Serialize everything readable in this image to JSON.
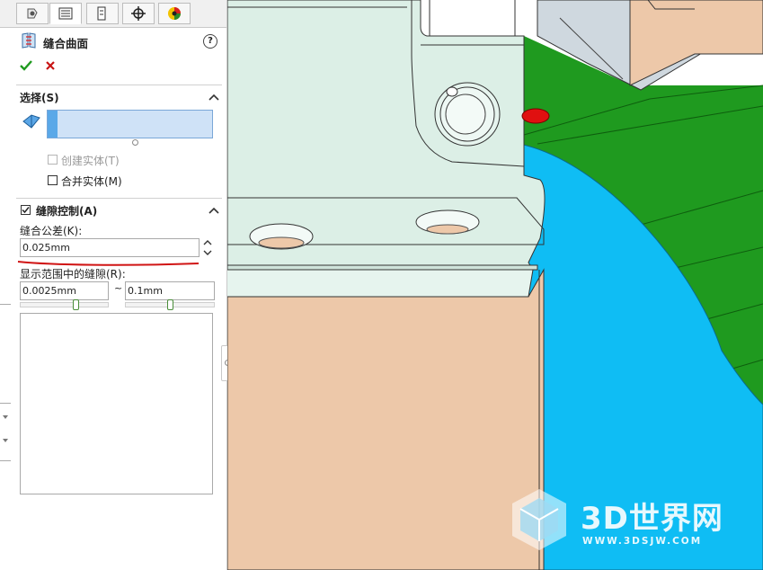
{
  "panel": {
    "title": "缝合曲面",
    "help_label": "?",
    "tabs": [
      "feature-manager",
      "property-manager",
      "configuration-manager",
      "dimxpert-manager",
      "display-manager"
    ]
  },
  "selection": {
    "header": "选择(S)",
    "create_solid": "创建实体(T)",
    "merge_entities": "合并实体(M)"
  },
  "gap_control": {
    "header": "缝隙控制(A)",
    "tolerance_label": "缝合公差(K):",
    "tolerance_value": "0.025mm",
    "range_label": "显示范围中的缝隙(R):",
    "range_min": "0.0025mm",
    "range_sep": "~",
    "range_max": "0.1mm"
  },
  "watermark": {
    "brand": "3D世界网",
    "url": "WWW.3DSJW.COM"
  },
  "colors": {
    "green_surface": "#1f9a1f",
    "blue_surface": "#0fbdf4",
    "tan_part": "#edc8a9",
    "mint_part": "#dcefe6",
    "red_marker": "#e01010"
  }
}
